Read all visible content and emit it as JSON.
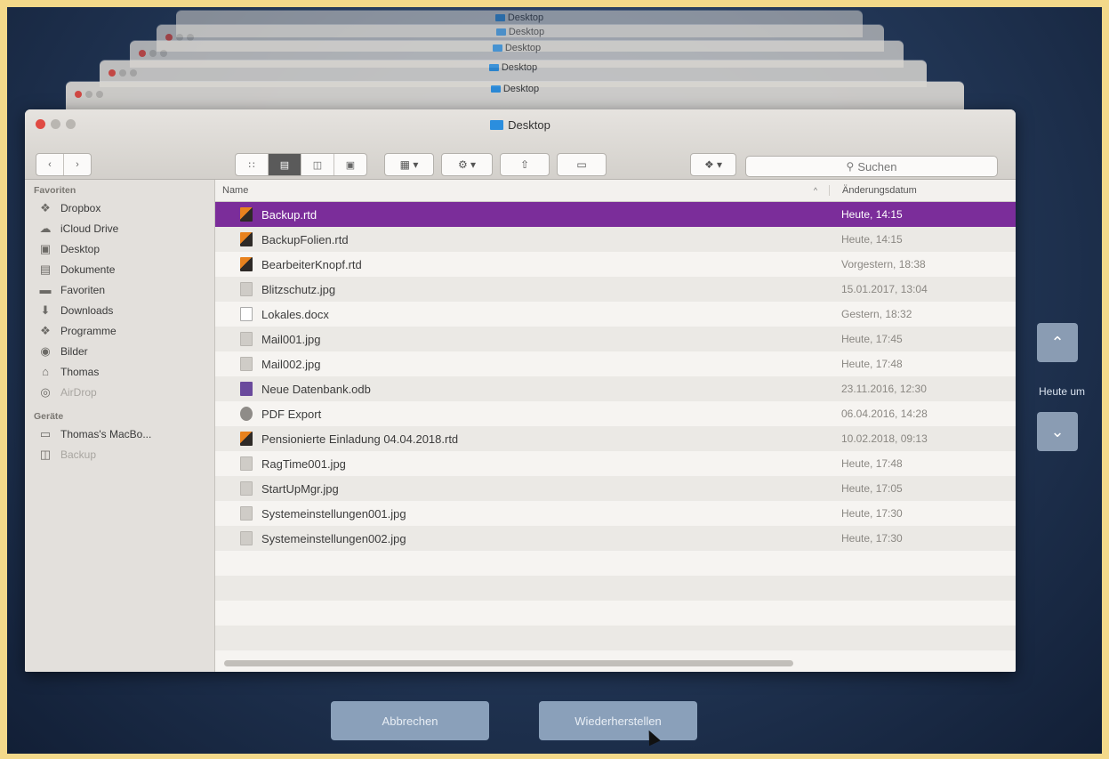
{
  "window": {
    "title": "Desktop",
    "stack_title": "Desktop"
  },
  "toolbar": {
    "search_placeholder": "Suchen",
    "view_icons": [
      "icon-view-icon",
      "list-view-icon",
      "column-view-icon",
      "cover-flow-icon"
    ]
  },
  "sidebar": {
    "favorites_header": "Favoriten",
    "favorites": [
      {
        "label": "Dropbox",
        "icon": "dropbox-icon"
      },
      {
        "label": "iCloud Drive",
        "icon": "cloud-icon"
      },
      {
        "label": "Desktop",
        "icon": "desktop-icon"
      },
      {
        "label": "Dokumente",
        "icon": "documents-icon"
      },
      {
        "label": "Favoriten",
        "icon": "folder-icon"
      },
      {
        "label": "Downloads",
        "icon": "download-icon"
      },
      {
        "label": "Programme",
        "icon": "applications-icon"
      },
      {
        "label": "Bilder",
        "icon": "camera-icon"
      },
      {
        "label": "Thomas",
        "icon": "home-icon"
      },
      {
        "label": "AirDrop",
        "icon": "airdrop-icon"
      }
    ],
    "devices_header": "Geräte",
    "devices": [
      {
        "label": "Thomas's MacBo...",
        "icon": "laptop-icon"
      },
      {
        "label": "Backup",
        "icon": "disk-icon"
      }
    ]
  },
  "list": {
    "col_name": "Name",
    "col_date": "Änderungsdatum",
    "sort_indicator": "^",
    "files": [
      {
        "name": "Backup.rtd",
        "date": "Heute, 14:15",
        "type": "rtd",
        "selected": true
      },
      {
        "name": "BackupFolien.rtd",
        "date": "Heute, 14:15",
        "type": "rtd"
      },
      {
        "name": "BearbeiterKnopf.rtd",
        "date": "Vorgestern, 18:38",
        "type": "rtd"
      },
      {
        "name": "Blitzschutz.jpg",
        "date": "15.01.2017, 13:04",
        "type": "jpg"
      },
      {
        "name": "Lokales.docx",
        "date": "Gestern, 18:32",
        "type": "doc"
      },
      {
        "name": "Mail001.jpg",
        "date": "Heute, 17:45",
        "type": "jpg"
      },
      {
        "name": "Mail002.jpg",
        "date": "Heute, 17:48",
        "type": "jpg"
      },
      {
        "name": "Neue Datenbank.odb",
        "date": "23.11.2016, 12:30",
        "type": "odb"
      },
      {
        "name": "PDF Export",
        "date": "06.04.2016, 14:28",
        "type": "app"
      },
      {
        "name": "Pensionierte Einladung 04.04.2018.rtd",
        "date": "10.02.2018, 09:13",
        "type": "rtd"
      },
      {
        "name": "RagTime001.jpg",
        "date": "Heute, 17:48",
        "type": "jpg"
      },
      {
        "name": "StartUpMgr.jpg",
        "date": "Heute, 17:05",
        "type": "jpg"
      },
      {
        "name": "Systemeinstellungen001.jpg",
        "date": "Heute, 17:30",
        "type": "jpg"
      },
      {
        "name": "Systemeinstellungen002.jpg",
        "date": "Heute, 17:30",
        "type": "jpg"
      }
    ]
  },
  "timeline": {
    "label": "Heute um"
  },
  "actions": {
    "cancel_label": "Abbrechen",
    "restore_label": "Wiederherstellen"
  },
  "colors": {
    "selection": "#7b2d9a",
    "folder": "#2b8ede",
    "desktop_bg": "#213554",
    "button": "#8aa0ba"
  }
}
